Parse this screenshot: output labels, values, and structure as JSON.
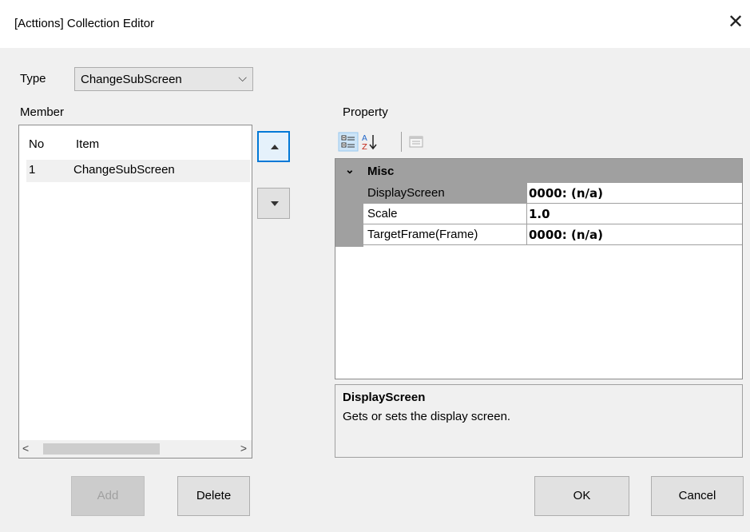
{
  "window": {
    "title": "[Acttions] Collection Editor",
    "close_glyph": "✕"
  },
  "type_selector": {
    "label": "Type",
    "value": "ChangeSubScreen"
  },
  "member": {
    "label": "Member",
    "columns": [
      "No",
      "Item"
    ],
    "rows": [
      {
        "no": "1",
        "item": "ChangeSubScreen"
      }
    ]
  },
  "property": {
    "label": "Property",
    "toolbar": {
      "categorized_icon": "categorized-view-icon",
      "alphabetical_icon": "sort-az-icon",
      "pages_icon": "property-pages-icon"
    },
    "category": "Misc",
    "rows": [
      {
        "name": "DisplayScreen",
        "value": "0000: (n/a)"
      },
      {
        "name": "Scale",
        "value": "1.0"
      },
      {
        "name": "TargetFrame(Frame)",
        "value": "0000: (n/a)"
      }
    ],
    "description": {
      "title": "DisplayScreen",
      "text": "Gets or sets the display screen."
    }
  },
  "buttons": {
    "add": "Add",
    "delete": "Delete",
    "ok": "OK",
    "cancel": "Cancel"
  },
  "colors": {
    "accent": "#0078d7",
    "category_bg": "#a0a0a0",
    "window_bg": "#f0f0f0"
  }
}
